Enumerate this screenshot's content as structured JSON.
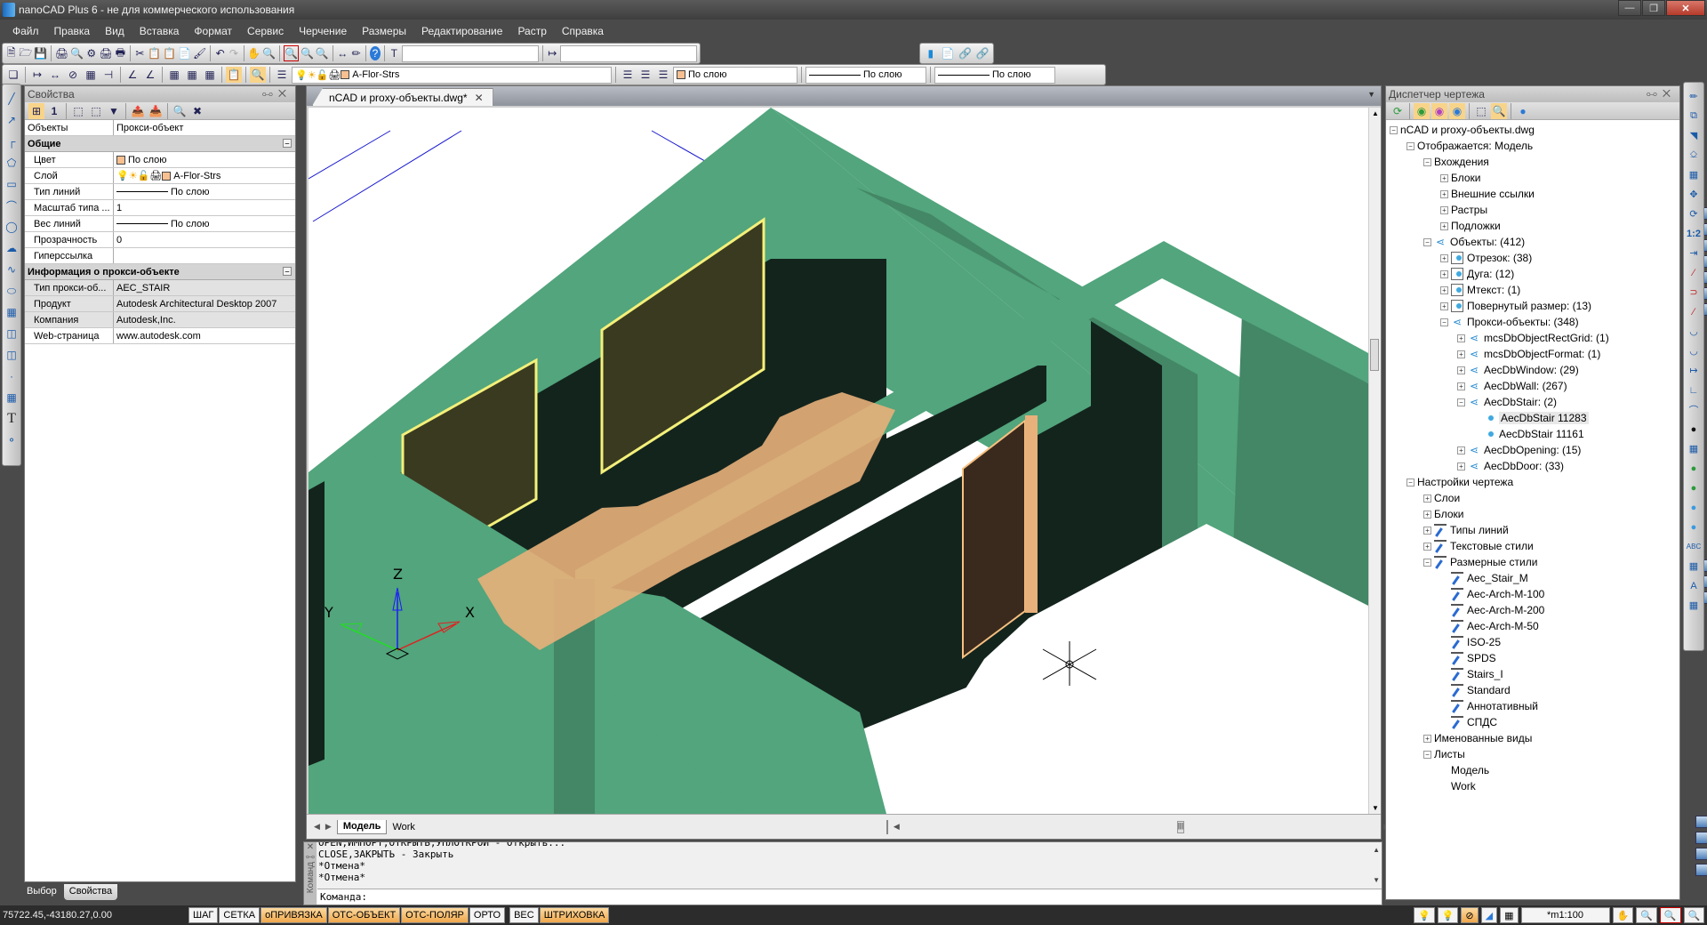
{
  "window": {
    "title": "nanoCAD Plus 6 - не для коммерческого использования",
    "buttons": [
      "minimize",
      "maximize",
      "close"
    ]
  },
  "menu": [
    "Файл",
    "Правка",
    "Вид",
    "Вставка",
    "Формат",
    "Сервис",
    "Черчение",
    "Размеры",
    "Редактирование",
    "Растр",
    "Справка"
  ],
  "toolbar": {
    "text_style_combo": "",
    "dim_style_combo": "",
    "layer_combo": "A-Flor-Strs",
    "color_combo": "По слою",
    "linetype_combo": "По слою",
    "lineweight_combo": "По слою"
  },
  "properties_panel": {
    "title": "Свойства",
    "objects_label": "Объекты",
    "objects_value": "Прокси-объект",
    "general": {
      "header": "Общие",
      "rows": [
        {
          "key": "Цвет",
          "value": "По слою",
          "icon": "color-swatch"
        },
        {
          "key": "Слой",
          "value": "A-Flor-Strs",
          "icon": "layer-state"
        },
        {
          "key": "Тип линий",
          "value": "По слою",
          "icon": "line-sample"
        },
        {
          "key": "Масштаб типа ...",
          "value": "1"
        },
        {
          "key": "Вес линий",
          "value": "По слою",
          "icon": "line-sample"
        },
        {
          "key": "Прозрачность",
          "value": "0"
        },
        {
          "key": "Гиперссылка",
          "value": ""
        }
      ]
    },
    "proxy_info": {
      "header": "Информация о прокси-объекте",
      "rows": [
        {
          "key": "Тип прокси-об...",
          "value": "AEC_STAIR"
        },
        {
          "key": "Продукт",
          "value": "Autodesk Architectural Desktop 2007"
        },
        {
          "key": "Компания",
          "value": "Autodesk,Inc."
        },
        {
          "key": "Web-страница",
          "value": "www.autodesk.com"
        }
      ]
    },
    "tabs": [
      "Выбор",
      "Свойства"
    ],
    "active_tab": "Свойства"
  },
  "document": {
    "tab_title": "nCAD и proxy-объекты.dwg*",
    "layout_tabs": [
      "Модель",
      "Work"
    ],
    "active_layout": "Модель",
    "ucs_labels": {
      "x": "X",
      "y": "Y",
      "z": "Z"
    },
    "colors": {
      "wall_light": "#52a57c",
      "wall_mid": "#438766",
      "wall_dark": "#13241d",
      "window": "#3a3a20",
      "frame": "#f4f07a",
      "stair": "#e8b07a",
      "door": "#3a2a1e"
    }
  },
  "command_line": {
    "side_label": "Команд",
    "history": [
      "OPEN,ИМПОРТ,ОТКРЫТЬ,УПЛОТКРОИ - Открыть...",
      "CLOSE,ЗАКРЫТЬ - Закрыть",
      "*Отмена*",
      "*Отмена*"
    ],
    "prompt": "Команда:"
  },
  "status_bar": {
    "coords": "75722.45,-43180.27,0.00",
    "toggles": [
      {
        "label": "ШАГ",
        "on": false
      },
      {
        "label": "СЕТКА",
        "on": false
      },
      {
        "label": "оПРИВЯЗКА",
        "on": true
      },
      {
        "label": "ОТС-ОБЪЕКТ",
        "on": true
      },
      {
        "label": "ОТС-ПОЛЯР",
        "on": true
      },
      {
        "label": "ОРТО",
        "on": false
      },
      {
        "label": "ВЕС",
        "on": false
      },
      {
        "label": "ШТРИХОВКА",
        "on": true
      }
    ],
    "scale": "*m1:100"
  },
  "drawing_manager": {
    "title": "Диспетчер чертежа",
    "tree": [
      {
        "level": 0,
        "exp": "-",
        "icon": "doc",
        "label": "nCAD и proxy-объекты.dwg"
      },
      {
        "level": 1,
        "exp": "-",
        "icon": "layout",
        "label": "Отображается: Модель"
      },
      {
        "level": 2,
        "exp": "-",
        "icon": "xref",
        "label": "Вхождения"
      },
      {
        "level": 3,
        "exp": "+",
        "icon": "blocks",
        "label": "Блоки"
      },
      {
        "level": 3,
        "exp": "+",
        "icon": "xref",
        "label": "Внешние ссылки"
      },
      {
        "level": 3,
        "exp": "+",
        "icon": "raster",
        "label": "Растры"
      },
      {
        "level": 3,
        "exp": "+",
        "icon": "underlay",
        "label": "Подложки"
      },
      {
        "level": 2,
        "exp": "-",
        "icon": "objects",
        "label": "Объекты: (412)"
      },
      {
        "level": 3,
        "exp": "+",
        "icon": "entity",
        "label": "Отрезок: (38)"
      },
      {
        "level": 3,
        "exp": "+",
        "icon": "entity",
        "label": "Дуга: (12)"
      },
      {
        "level": 3,
        "exp": "+",
        "icon": "entity",
        "label": "Мтекст: (1)"
      },
      {
        "level": 3,
        "exp": "+",
        "icon": "entity",
        "label": "Повернутый размер: (13)"
      },
      {
        "level": 3,
        "exp": "-",
        "icon": "proxy",
        "label": "Прокси-объекты: (348)"
      },
      {
        "level": 4,
        "exp": "+",
        "icon": "proxy",
        "label": "mcsDbObjectRectGrid: (1)"
      },
      {
        "level": 4,
        "exp": "+",
        "icon": "proxy",
        "label": "mcsDbObjectFormat: (1)"
      },
      {
        "level": 4,
        "exp": "+",
        "icon": "proxy",
        "label": "AecDbWindow: (29)"
      },
      {
        "level": 4,
        "exp": "+",
        "icon": "proxy",
        "label": "AecDbWall: (267)"
      },
      {
        "level": 4,
        "exp": "-",
        "icon": "proxy",
        "label": "AecDbStair: (2)"
      },
      {
        "level": 5,
        "exp": "",
        "icon": "dot",
        "label": "AecDbStair 11283",
        "selected": true
      },
      {
        "level": 5,
        "exp": "",
        "icon": "dot",
        "label": "AecDbStair 11161"
      },
      {
        "level": 4,
        "exp": "+",
        "icon": "proxy",
        "label": "AecDbOpening: (15)"
      },
      {
        "level": 4,
        "exp": "+",
        "icon": "proxy",
        "label": "AecDbDoor: (33)"
      },
      {
        "level": 1,
        "exp": "-",
        "icon": "doc",
        "label": "Настройки чертежа"
      },
      {
        "level": 2,
        "exp": "+",
        "icon": "layers",
        "label": "Слои"
      },
      {
        "level": 2,
        "exp": "+",
        "icon": "blocks",
        "label": "Блоки"
      },
      {
        "level": 2,
        "exp": "+",
        "icon": "linetype",
        "label": "Типы линий"
      },
      {
        "level": 2,
        "exp": "+",
        "icon": "textstyle",
        "label": "Текстовые стили"
      },
      {
        "level": 2,
        "exp": "-",
        "icon": "dimstyle",
        "label": "Размерные стили"
      },
      {
        "level": 3,
        "exp": "",
        "icon": "dimstyle",
        "label": "Aec_Stair_M"
      },
      {
        "level": 3,
        "exp": "",
        "icon": "dimstyle",
        "label": "Aec-Arch-M-100"
      },
      {
        "level": 3,
        "exp": "",
        "icon": "dimstyle",
        "label": "Aec-Arch-M-200"
      },
      {
        "level": 3,
        "exp": "",
        "icon": "dimstyle",
        "label": "Aec-Arch-M-50"
      },
      {
        "level": 3,
        "exp": "",
        "icon": "dimstyle",
        "label": "ISO-25"
      },
      {
        "level": 3,
        "exp": "",
        "icon": "dimstyle",
        "label": "SPDS"
      },
      {
        "level": 3,
        "exp": "",
        "icon": "dimstyle",
        "label": "Stairs_I"
      },
      {
        "level": 3,
        "exp": "",
        "icon": "dimstyle",
        "label": "Standard"
      },
      {
        "level": 3,
        "exp": "",
        "icon": "dimstyle",
        "label": "Аннотативный"
      },
      {
        "level": 3,
        "exp": "",
        "icon": "dimstyle",
        "label": "СПДС"
      },
      {
        "level": 2,
        "exp": "+",
        "icon": "views",
        "label": "Именованные виды"
      },
      {
        "level": 2,
        "exp": "-",
        "icon": "layout",
        "label": "Листы"
      },
      {
        "level": 3,
        "exp": "",
        "icon": "layout",
        "label": "Модель"
      },
      {
        "level": 3,
        "exp": "",
        "icon": "layout",
        "label": "Work"
      }
    ]
  }
}
